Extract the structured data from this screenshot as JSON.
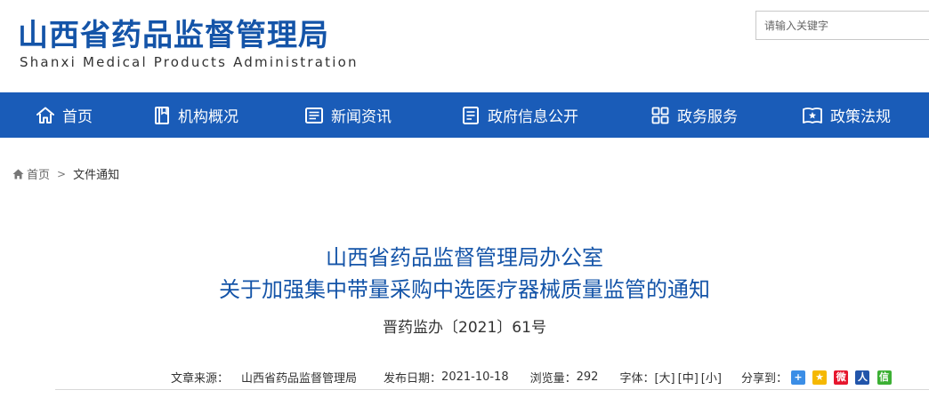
{
  "header": {
    "logo_cn": "山西省药品监督管理局",
    "logo_en": "Shanxi Medical Products Administration",
    "search_placeholder": "请输入关键字"
  },
  "nav": {
    "items": [
      {
        "label": "首页",
        "icon": "home-icon"
      },
      {
        "label": "机构概况",
        "icon": "book-icon"
      },
      {
        "label": "新闻资讯",
        "icon": "news-icon"
      },
      {
        "label": "政府信息公开",
        "icon": "document-icon"
      },
      {
        "label": "政务服务",
        "icon": "grid-icon"
      },
      {
        "label": "政策法规",
        "icon": "law-book-icon"
      }
    ],
    "bg_color": "#1a5cb8"
  },
  "breadcrumb": {
    "home": "首页",
    "current": "文件通知"
  },
  "article": {
    "title_line1": "山西省药品监督管理局办公室",
    "title_line2": "关于加强集中带量采购中选医疗器械质量监管的通知",
    "doc_number": "晋药监办〔2021〕61号",
    "source_label": "文章来源：",
    "source_value": "山西省药品监督管理局",
    "date_label": "发布日期：",
    "date_value": "2021-10-18",
    "views_label": "浏览量：",
    "views_value": "292",
    "font_label": "字体：",
    "font_large": "[大]",
    "font_medium": "[中]",
    "font_small": "[小]",
    "share_label": "分享到："
  },
  "colors": {
    "brand": "#1454a8",
    "title": "#1454a8"
  }
}
